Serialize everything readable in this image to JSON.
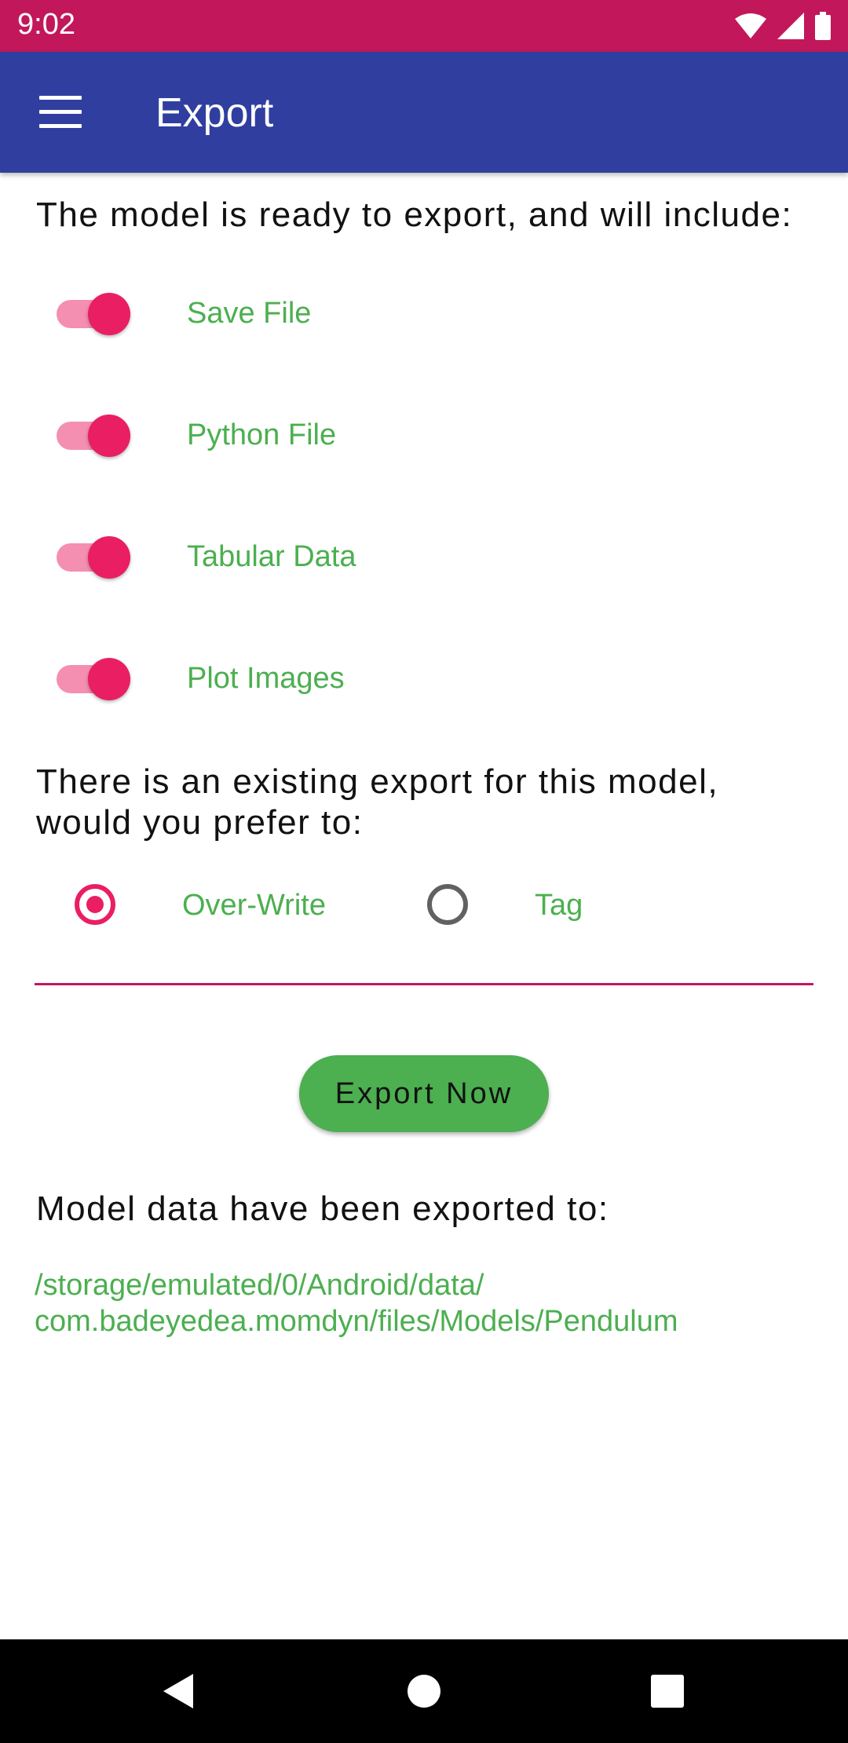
{
  "status_bar": {
    "time": "9:02"
  },
  "app_bar": {
    "title": "Export",
    "menu_icon": "hamburger-menu-icon"
  },
  "intro_text": "The model is ready to export, and will include:",
  "include_options": [
    {
      "label": "Save File",
      "checked": true
    },
    {
      "label": "Python File",
      "checked": true
    },
    {
      "label": "Tabular Data",
      "checked": true
    },
    {
      "label": "Plot Images",
      "checked": true
    }
  ],
  "existing_export_question": "There is an existing export for this model, would you prefer to:",
  "radio_options": [
    {
      "label": "Over-Write",
      "selected": true
    },
    {
      "label": "Tag",
      "selected": false
    }
  ],
  "export_button_label": "Export Now",
  "result_text": "Model data have been exported to:",
  "export_path": "/storage/emulated/0/Android/data/\ncom.badeyedea.momdyn/files/Models/Pendulum",
  "colors": {
    "status_bar": "#C2185B",
    "app_bar": "#303F9F",
    "accent": "#E91E63",
    "label_green": "#4CAF50",
    "button_green": "#4CAF50"
  }
}
